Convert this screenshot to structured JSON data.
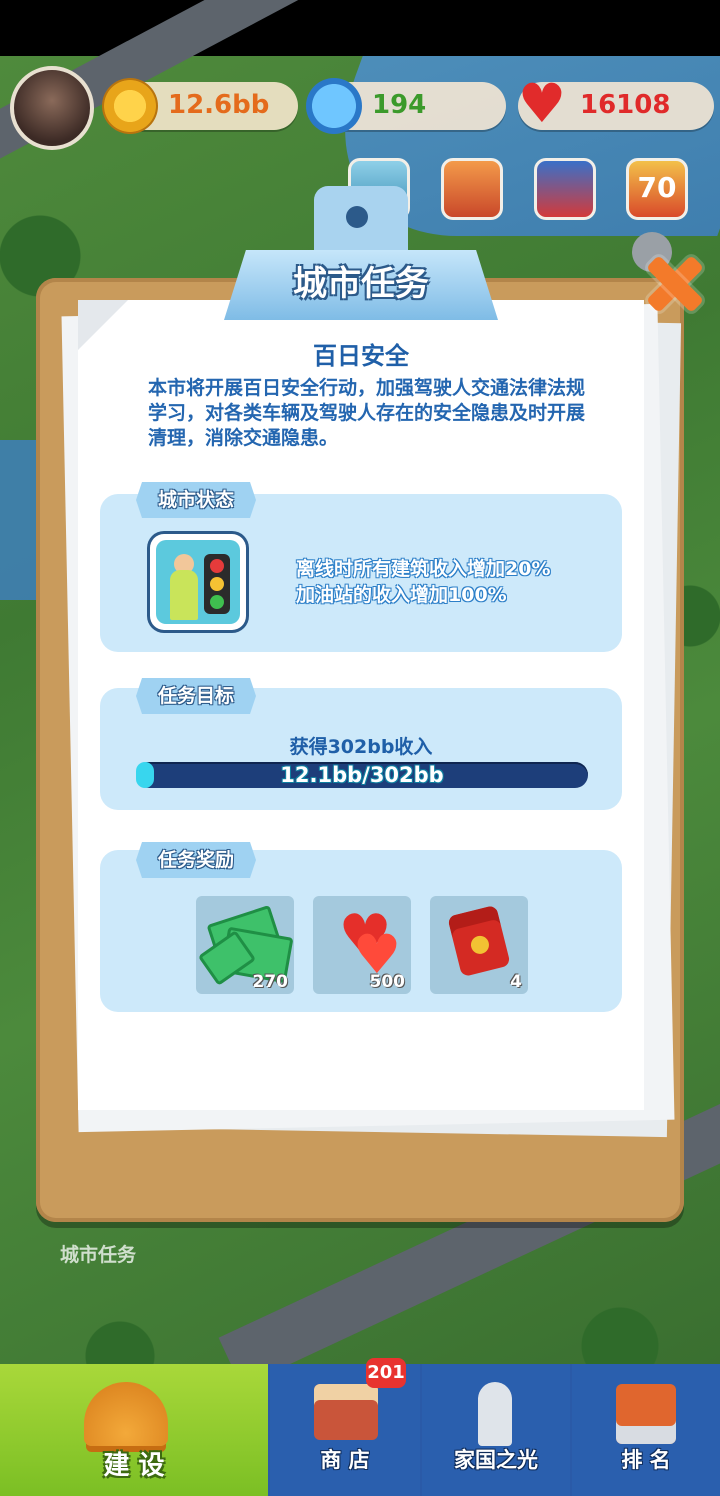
{
  "hud": {
    "coins": "12.6bb",
    "stars": "194",
    "hearts": "16108",
    "event_badge": "70"
  },
  "panel": {
    "title": "城市任务",
    "task_name": "百日安全",
    "task_description": "本市将开展百日安全行动，加强驾驶人交通法律法规学习，对各类车辆及驾驶人存在的安全隐患及时开展清理，消除交通隐患。",
    "status": {
      "label": "城市状态",
      "effect_1": "离线时所有建筑收入增加20%",
      "effect_2": "加油站的收入增加100%"
    },
    "goal": {
      "label": "任务目标",
      "text": "获得302bb收入",
      "progress_text": "12.1bb/302bb",
      "progress_fraction": 0.04
    },
    "reward": {
      "label": "任务奖励",
      "items": [
        {
          "icon": "cash-stack-icon",
          "quantity": "270"
        },
        {
          "icon": "hearts-icon",
          "quantity": "500"
        },
        {
          "icon": "red-envelope-icon",
          "quantity": "4"
        }
      ]
    }
  },
  "background_label": "城市任务",
  "nav": {
    "build": "建 设",
    "shop": "商 店",
    "shop_badge": "201",
    "glory": "家国之光",
    "rank": "排 名"
  },
  "colors": {
    "panel_board": "#c99b5c",
    "accent_blue": "#1f5fa8",
    "progress_fill": "#38d6ee",
    "nav_active": "#8ccb2c",
    "nav_bg": "#2a5fae"
  }
}
